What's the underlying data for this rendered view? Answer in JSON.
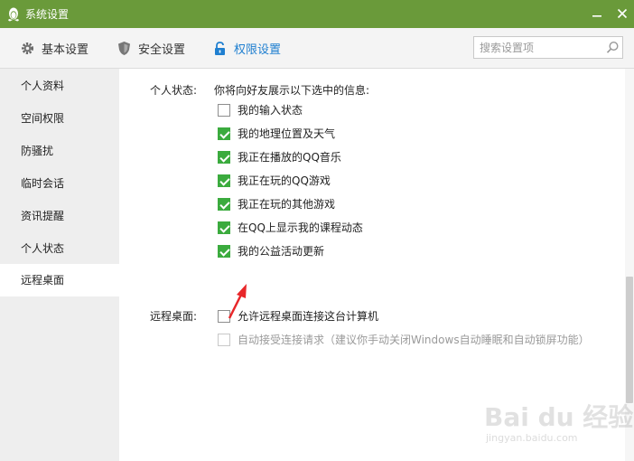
{
  "window": {
    "title": "系统设置",
    "logo_icon": "qq-penguin-icon",
    "accent_color": "#6a9a3a"
  },
  "toolbar": {
    "tabs": [
      {
        "label": "基本设置",
        "icon": "gear-icon"
      },
      {
        "label": "安全设置",
        "icon": "shield-icon"
      },
      {
        "label": "权限设置",
        "icon": "lock-icon",
        "active": true
      }
    ],
    "search": {
      "placeholder": "搜索设置项",
      "value": ""
    }
  },
  "sidebar": {
    "items": [
      {
        "label": "个人资料"
      },
      {
        "label": "空间权限"
      },
      {
        "label": "防骚扰"
      },
      {
        "label": "临时会话"
      },
      {
        "label": "资讯提醒"
      },
      {
        "label": "个人状态"
      },
      {
        "label": "远程桌面",
        "active": true
      }
    ]
  },
  "personal_status": {
    "section_label": "个人状态:",
    "intro": "你将向好友展示以下选中的信息:",
    "options": [
      {
        "label": "我的输入状态",
        "checked": false
      },
      {
        "label": "我的地理位置及天气",
        "checked": true
      },
      {
        "label": "我正在播放的QQ音乐",
        "checked": true
      },
      {
        "label": "我正在玩的QQ游戏",
        "checked": true
      },
      {
        "label": "我正在玩的其他游戏",
        "checked": true
      },
      {
        "label": "在QQ上显示我的课程动态",
        "checked": true
      },
      {
        "label": "我的公益活动更新",
        "checked": true
      }
    ]
  },
  "remote_desktop": {
    "section_label": "远程桌面:",
    "options": [
      {
        "label": "允许远程桌面连接这台计算机",
        "checked": false,
        "disabled": false
      },
      {
        "label": "自动接受连接请求（建议你手动关闭Windows自动睡眠和自动锁屏功能）",
        "checked": false,
        "disabled": true
      }
    ]
  },
  "watermark": {
    "line1": "Bai du 经验",
    "line2": "jingyan.baidu.com"
  },
  "colors": {
    "check_green": "#3bab3e",
    "active_tab_blue": "#1f7fd0",
    "annotation_red": "#e8272a"
  }
}
